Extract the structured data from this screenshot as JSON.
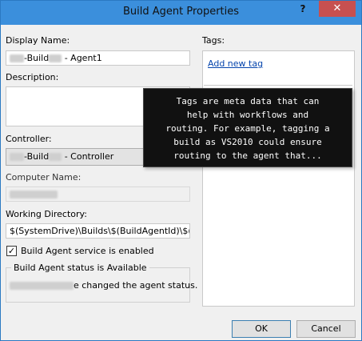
{
  "window": {
    "title": "Build Agent Properties",
    "help_glyph": "?",
    "close_glyph": "✕"
  },
  "display_name": {
    "label": "Display Name:",
    "value_mid": "-Build",
    "value_end": " - Agent1"
  },
  "description": {
    "label": "Description:"
  },
  "controller": {
    "label": "Controller:",
    "value_mid": "-Build",
    "value_end": " - Controller"
  },
  "computer_name": {
    "label": "Computer Name:"
  },
  "working_directory": {
    "label": "Working Directory:",
    "value": "$(SystemDrive)\\Builds\\$(BuildAgentId)\\$(Bu"
  },
  "service_enabled": {
    "label": "Build Agent service is enabled",
    "checked_glyph": "✓"
  },
  "status": {
    "title": "Build Agent status is Available",
    "message": "e changed the agent status."
  },
  "tags": {
    "label": "Tags:",
    "add_link": "Add new tag",
    "tooltip_lines": [
      "Tags are meta data that can",
      "help with workflows and",
      "routing. For example, tagging a",
      "build as VS2010 could ensure",
      "routing to the agent that..."
    ]
  },
  "buttons": {
    "ok": "OK",
    "cancel": "Cancel"
  },
  "colors": {
    "titlebar": "#3b8fdc",
    "close": "#c75050",
    "link": "#0645ad"
  }
}
